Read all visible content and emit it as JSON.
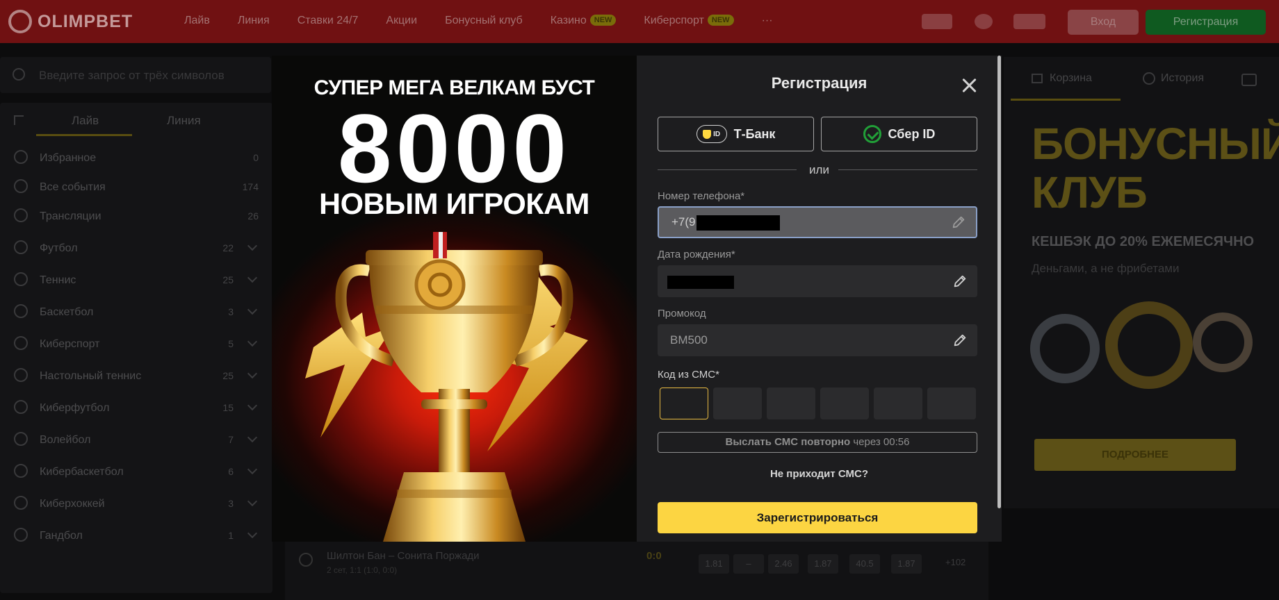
{
  "header": {
    "brand": "OLIMPBET",
    "nav": [
      {
        "label": "Лайв",
        "badge": ""
      },
      {
        "label": "Линия",
        "badge": ""
      },
      {
        "label": "Ставки 24/7",
        "badge": ""
      },
      {
        "label": "Акции",
        "badge": ""
      },
      {
        "label": "Бонусный клуб",
        "badge": ""
      },
      {
        "label": "Казино",
        "badge": "NEW"
      },
      {
        "label": "Киберспорт",
        "badge": "NEW"
      },
      {
        "label": "···",
        "badge": ""
      }
    ],
    "login_label": "Вход",
    "register_label": "Регистрация"
  },
  "sidebar": {
    "search_placeholder": "Введите запрос от трёх символов",
    "tabs": [
      "Лайв",
      "Линия"
    ],
    "items": [
      {
        "label": "Избранное",
        "count": "0",
        "icon": "star-icon",
        "expandable": false
      },
      {
        "label": "Все события",
        "count": "174",
        "icon": "all-events-icon",
        "expandable": false
      },
      {
        "label": "Трансляции",
        "count": "26",
        "icon": "tv-icon",
        "expandable": false
      },
      {
        "label": "Футбол",
        "count": "22",
        "icon": "football-icon",
        "expandable": true
      },
      {
        "label": "Теннис",
        "count": "25",
        "icon": "tennis-icon",
        "expandable": true
      },
      {
        "label": "Баскетбол",
        "count": "3",
        "icon": "basketball-icon",
        "expandable": true
      },
      {
        "label": "Киберспорт",
        "count": "5",
        "icon": "gamepad-icon",
        "expandable": true
      },
      {
        "label": "Настольный теннис",
        "count": "25",
        "icon": "table-tennis-icon",
        "expandable": true
      },
      {
        "label": "Киберфутбол",
        "count": "15",
        "icon": "gamepad-icon",
        "expandable": true
      },
      {
        "label": "Волейбол",
        "count": "7",
        "icon": "volleyball-icon",
        "expandable": true
      },
      {
        "label": "Кибербаскетбол",
        "count": "6",
        "icon": "gamepad-icon",
        "expandable": true
      },
      {
        "label": "Киберхоккей",
        "count": "3",
        "icon": "gamepad-icon",
        "expandable": true
      },
      {
        "label": "Гандбол",
        "count": "1",
        "icon": "handball-icon",
        "expandable": true
      }
    ]
  },
  "right_panel": {
    "tabs": [
      "Корзина",
      "История"
    ],
    "bonus_title": [
      "БОНУСНЫЙ",
      "КЛУБ"
    ],
    "bonus_subtitle": "КЕШБЭК ДО 20% ЕЖЕМЕСЯЧНО",
    "bonus_text": "Деньгами, а не фрибетами",
    "more_label": "ПОДРОБНЕЕ"
  },
  "match_strip": {
    "teams": "Шилтон Бан – Сонита Поржади",
    "score": "0:0",
    "meta": "2 сет, 1:1 (1:0, 0:0)",
    "odds": [
      "1.81",
      "–",
      "2.46",
      "1.87",
      "40.5",
      "1.87"
    ],
    "more": "+102"
  },
  "promo": {
    "line1": "СУПЕР МЕГА ВЕЛКАМ БУСТ",
    "number": "8000",
    "line2": "НОВЫМ ИГРОКАМ"
  },
  "registration": {
    "title": "Регистрация",
    "tbank_label": "Т-Банк",
    "tbank_id_text": "ID",
    "sber_label": "Сбер ID",
    "or_text": "или",
    "phone_label": "Номер телефона*",
    "phone_value": "+7(9",
    "birth_label": "Дата рождения*",
    "birth_value": "",
    "promo_label": "Промокод",
    "promo_value": "BM500",
    "sms_label": "Код из СМС*",
    "sms_cells": [
      "",
      "",
      "",
      "",
      "",
      ""
    ],
    "resend_bold": "Выслать СМС повторно",
    "resend_rest": " через 00:56",
    "no_sms_text": "Не приходит СМС?",
    "submit_label": "Зарегистрироваться"
  },
  "colors": {
    "header_bg": "#701112",
    "accent_yellow": "#fcd542",
    "sber_green": "#21a038",
    "register_green": "#0f5a20"
  }
}
